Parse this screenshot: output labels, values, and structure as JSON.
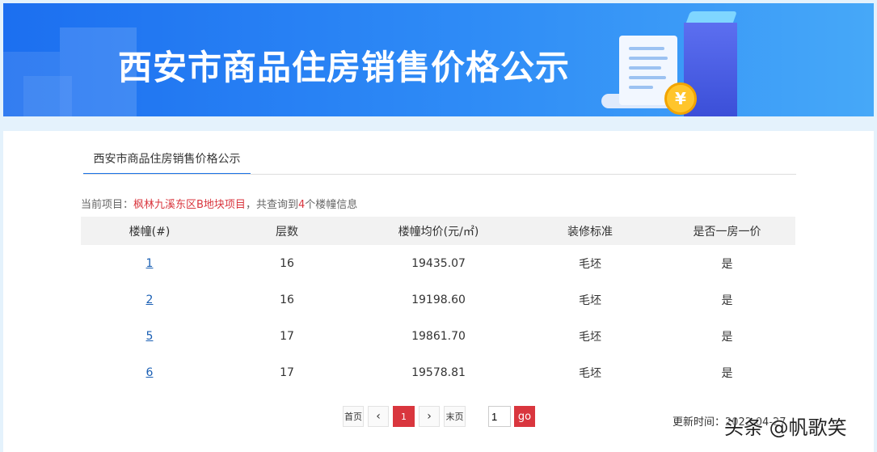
{
  "banner": {
    "title": "西安市商品住房销售价格公示",
    "coin_symbol": "¥"
  },
  "tab": {
    "label": "西安市商品住房销售价格公示"
  },
  "info": {
    "prefix": "当前项目：",
    "project": "枫林九溪东区B地块项目",
    "middle": "，共查询到",
    "count": "4",
    "suffix": "个楼幢信息"
  },
  "table": {
    "headers": [
      "楼幢(#)",
      "层数",
      "楼幢均价(元/㎡)",
      "装修标准",
      "是否一房一价"
    ],
    "rows": [
      {
        "building": "1",
        "floors": "16",
        "price": "19435.07",
        "decoration": "毛坯",
        "one_price": "是"
      },
      {
        "building": "2",
        "floors": "16",
        "price": "19198.60",
        "decoration": "毛坯",
        "one_price": "是"
      },
      {
        "building": "5",
        "floors": "17",
        "price": "19861.70",
        "decoration": "毛坯",
        "one_price": "是"
      },
      {
        "building": "6",
        "floors": "17",
        "price": "19578.81",
        "decoration": "毛坯",
        "one_price": "是"
      }
    ]
  },
  "pager": {
    "first": "首页",
    "prev": "‹",
    "current": "1",
    "next": "›",
    "last": "末页",
    "input_value": "1",
    "go": "go"
  },
  "update": {
    "label": "更新时间：",
    "value": "2022-04-27"
  },
  "watermark": "头条 @帆歌笑",
  "colors": {
    "accent_red": "#d9363e",
    "link_blue": "#1a5fb4",
    "banner_blue": "#1c6ff0"
  }
}
